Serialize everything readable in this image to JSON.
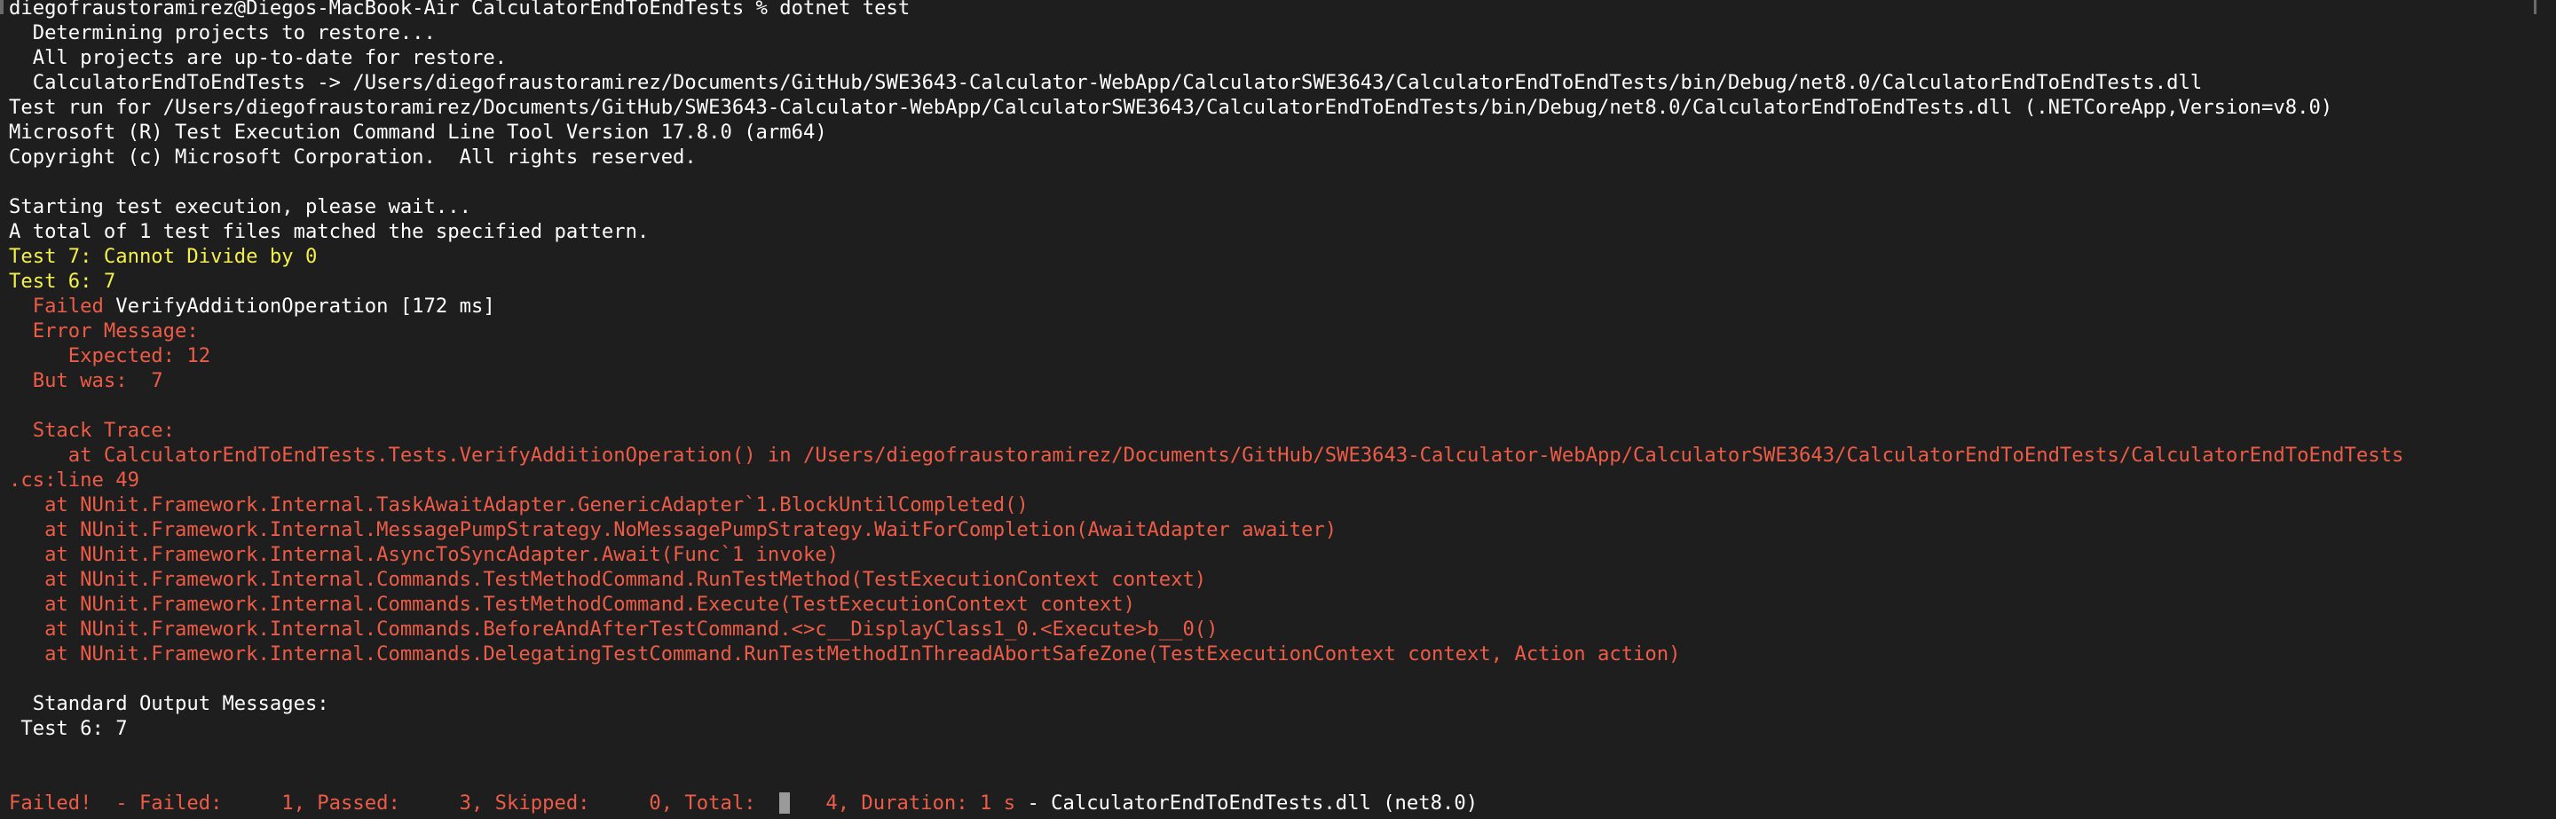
{
  "terminal": {
    "colors": {
      "background": "#1e1e1e",
      "default": "#ffffff",
      "highlight": "#f4ef4b",
      "error": "#ec5c47",
      "cursor": "#9a9a9a"
    },
    "prompt": "diegofraustoramirez@Diegos-MacBook-Air CalculatorEndToEndTests % dotnet test",
    "restore_lines": [
      "  Determining projects to restore...",
      "  All projects are up-to-date for restore.",
      "  CalculatorEndToEndTests -> /Users/diegofraustoramirez/Documents/GitHub/SWE3643-Calculator-WebApp/CalculatorSWE3643/CalculatorEndToEndTests/bin/Debug/net8.0/CalculatorEndToEndTests.dll"
    ],
    "test_run_line": "Test run for /Users/diegofraustoramirez/Documents/GitHub/SWE3643-Calculator-WebApp/CalculatorSWE3643/CalculatorEndToEndTests/bin/Debug/net8.0/CalculatorEndToEndTests.dll (.NETCoreApp,Version=v8.0)",
    "tool_line": "Microsoft (R) Test Execution Command Line Tool Version 17.8.0 (arm64)",
    "copyright_line": "Copyright (c) Microsoft Corporation.  All rights reserved.",
    "starting_line": "Starting test execution, please wait...",
    "pattern_line": "A total of 1 test files matched the specified pattern.",
    "output_7": "Test 7: Cannot Divide by 0",
    "output_6": "Test 6: 7",
    "failed_prefix": "  Failed ",
    "failed_name": "VerifyAdditionOperation [172 ms]",
    "error_message_label": "  Error Message:",
    "expected_line": "     Expected: 12",
    "but_was_line": "  But was:  7",
    "stack_trace_label": "  Stack Trace:",
    "stack_first_line": "     at CalculatorEndToEndTests.Tests.VerifyAdditionOperation() in /Users/diegofraustoramirez/Documents/GitHub/SWE3643-Calculator-WebApp/CalculatorSWE3643/CalculatorEndToEndTests/CalculatorEndToEndTests",
    "stack_wrap_line": ".cs:line 49",
    "stack_frames": [
      "   at NUnit.Framework.Internal.TaskAwaitAdapter.GenericAdapter`1.BlockUntilCompleted()",
      "   at NUnit.Framework.Internal.MessagePumpStrategy.NoMessagePumpStrategy.WaitForCompletion(AwaitAdapter awaiter)",
      "   at NUnit.Framework.Internal.AsyncToSyncAdapter.Await(Func`1 invoke)",
      "   at NUnit.Framework.Internal.Commands.TestMethodCommand.RunTestMethod(TestExecutionContext context)",
      "   at NUnit.Framework.Internal.Commands.TestMethodCommand.Execute(TestExecutionContext context)",
      "   at NUnit.Framework.Internal.Commands.BeforeAndAfterTestCommand.<>c__DisplayClass1_0.<Execute>b__0()",
      "   at NUnit.Framework.Internal.Commands.DelegatingTestCommand.RunTestMethodInThreadAbortSafeZone(TestExecutionContext context, Action action)"
    ],
    "std_output_label": "  Standard Output Messages:",
    "std_output_value": " Test 6: 7",
    "summary": {
      "failed_part1": "Failed!  - Failed:     1, Passed:     3, Skipped:     0, Total:  ",
      "failed_part2": "   4, Duration: 1 s",
      "dash": " - ",
      "assembly": "CalculatorEndToEndTests.dll (net8.0)"
    }
  }
}
